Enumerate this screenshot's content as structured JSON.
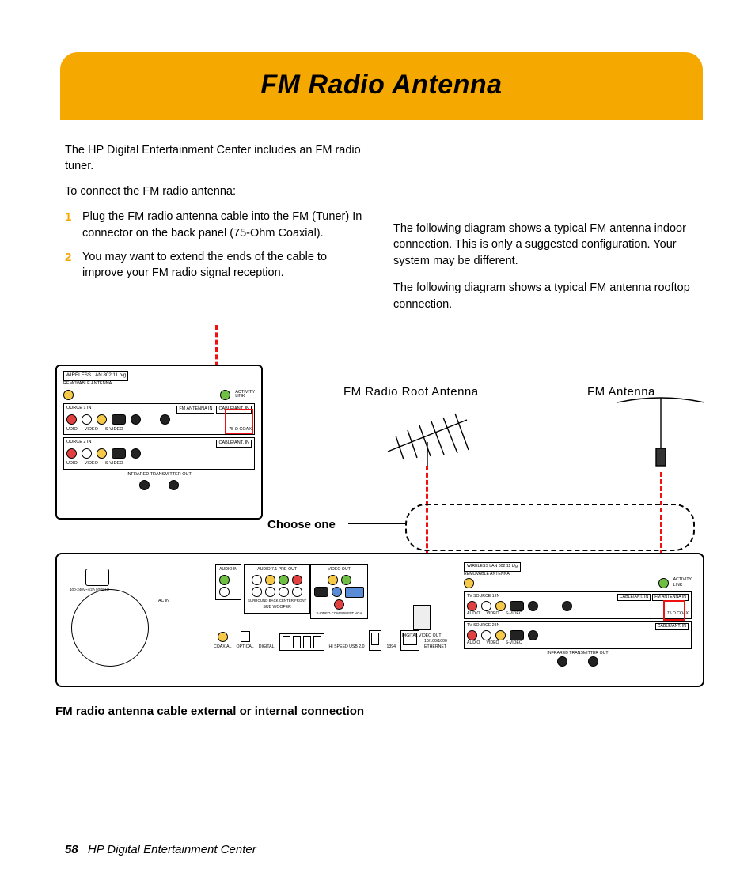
{
  "header": {
    "title": "FM Radio Antenna"
  },
  "intro": {
    "p1": "The HP Digital Entertainment Center includes an FM radio tuner.",
    "p2": "To connect the FM radio antenna:"
  },
  "steps": [
    {
      "n": "1",
      "text": "Plug the FM radio antenna cable into the FM (Tuner) In connector on the back panel (75-Ohm Coaxial)."
    },
    {
      "n": "2",
      "text": "You may want to extend the ends of the cable to improve your FM radio signal reception."
    }
  ],
  "right": {
    "p1": "The following diagram shows a typical FM antenna indoor connection. This is only a suggested configuration. Your system may be different.",
    "p2": "The following diagram shows a typical FM antenna rooftop connection."
  },
  "diagram": {
    "roof_label": "FM Radio Roof Antenna",
    "dipole_label": "FM Antenna",
    "choose": "Choose one",
    "caption": "FM radio antenna cable external or internal connection",
    "closeup": {
      "wlan": "WIRELESS LAN       802.11 b/g",
      "rem": "REMOVABLE ANTENNA",
      "activity": "ACTIVITY",
      "link": "LINK",
      "src1": "OURCE   1   IN",
      "src2": "OURCE   2   IN",
      "cable": "CABLE/ANT. IN",
      "fmant": "FM ANTENNA IN",
      "audio": "UDIO",
      "video": "VIDEO",
      "svideo": "S-VIDEO",
      "coax": "75 Ω COAX",
      "ir": "INFRARED TRANSMITTER OUT"
    },
    "backpanel": {
      "audioin": "AUDIO IN",
      "preout": "AUDIO 7.1 PRE-OUT",
      "surround": "SURROUND",
      "back": "BACK",
      "center": "CENTER",
      "front": "FRONT",
      "sub": "SUB WOOFER",
      "videoout": "VIDEO        OUT",
      "svideo": "S-VIDEO",
      "component": "COMPONENT",
      "vga": "VGA",
      "acin": "AC IN",
      "acspec": "100-240V~4/2A  50/60Hz",
      "digital": "DIGITAL",
      "coaxial": "COAXIAL",
      "optical": "OPTICAL",
      "usb": "HI SPEED USB 2.0",
      "fw": "1394",
      "eth": "ETHERNET",
      "ethspeed": "10/100/1000",
      "dvo": "DIGITAL VIDEO OUT",
      "wlan": "WIRELESS LAN       802.11 b/g",
      "rem": "REMOVABLE ANTENNA",
      "activity": "ACTIVITY",
      "link": "LINK",
      "tv1": "TV SOURCE   1   IN",
      "tv2": "TV SOURCE   2   IN",
      "cable": "CABLE/ANT. IN",
      "fmant": "FM ANTENNA IN",
      "audio": "AUDIO",
      "video": "VIDEO",
      "ir": "INFRARED TRANSMITTER OUT",
      "coax": "75 Ω COAX"
    }
  },
  "footer": {
    "page": "58",
    "book": "HP Digital Entertainment Center"
  }
}
